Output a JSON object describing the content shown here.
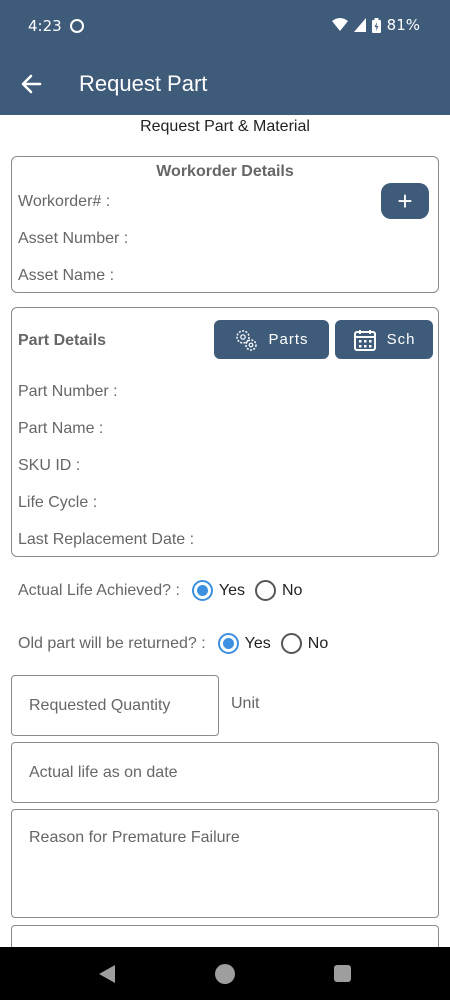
{
  "status": {
    "time": "4:23",
    "battery": "81%"
  },
  "app": {
    "title": "Request Part",
    "subtitle": "Request Part & Material"
  },
  "workorder": {
    "title": "Workorder Details",
    "fields": [
      "Workorder# :",
      "Asset Number :",
      "Asset Name :"
    ],
    "add_label": "+"
  },
  "part": {
    "title": "Part Details",
    "parts_button": "Parts",
    "sch_button": "Sch",
    "fields": [
      "Part Number :",
      "Part Name :",
      "SKU ID :",
      "Life Cycle :",
      "Last Replacement Date :"
    ]
  },
  "questions": {
    "life_achieved": {
      "label": "Actual Life Achieved? :",
      "yes": "Yes",
      "no": "No",
      "selected": "Yes"
    },
    "old_part": {
      "label": "Old part will be returned? :",
      "yes": "Yes",
      "no": "No",
      "selected": "Yes"
    }
  },
  "inputs": {
    "requested_quantity": "Requested Quantity",
    "unit": "Unit",
    "actual_life": "Actual life as on date",
    "reason": "Reason for Premature Failure"
  },
  "colors": {
    "primary": "#3f5b7a",
    "radio_accent": "#3d8fe0"
  }
}
